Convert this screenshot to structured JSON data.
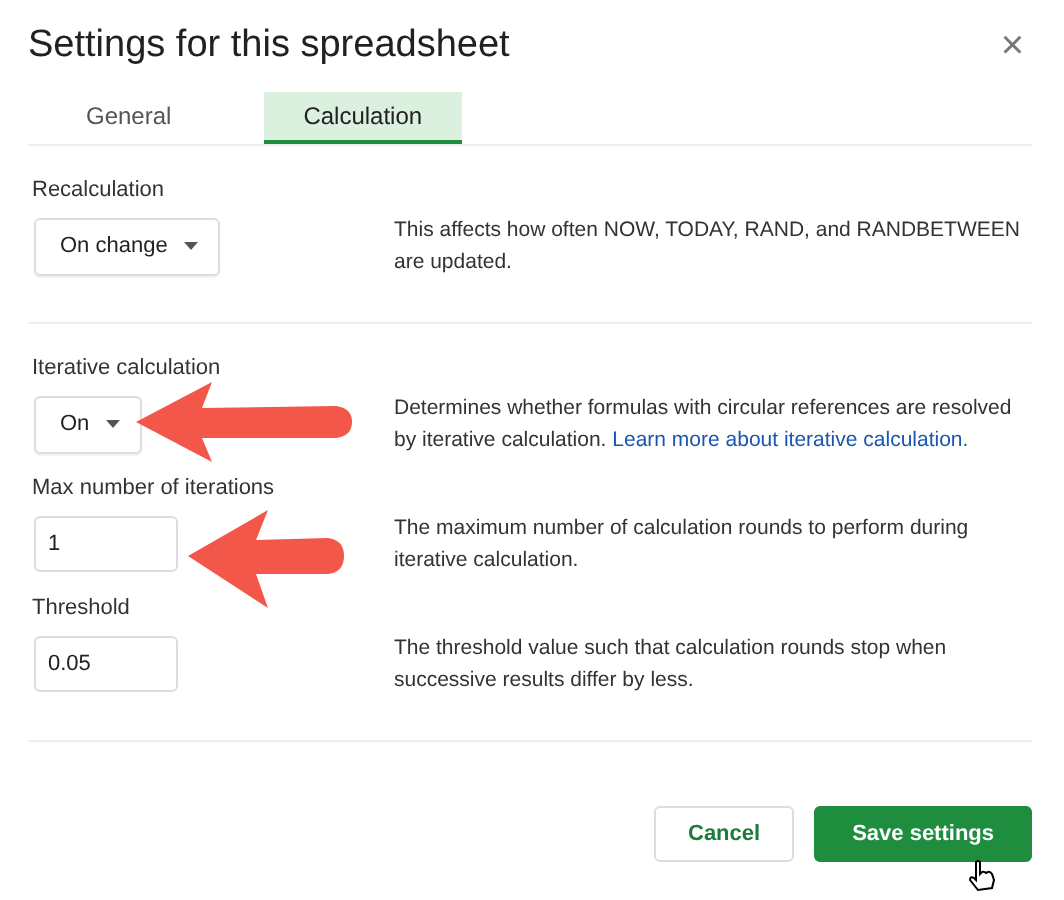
{
  "window": {
    "title": "Settings for this spreadsheet",
    "close": "×"
  },
  "tabs": [
    {
      "label": "General",
      "selected": false
    },
    {
      "label": "Calculation",
      "selected": true
    }
  ],
  "groups": [
    [
      {
        "kind": "dropdown",
        "label": "Recalculation",
        "value": "On change",
        "description": "This affects how often NOW, TODAY, RAND, and RANDBETWEEN are updated."
      }
    ],
    [
      {
        "kind": "dropdown",
        "label": "Iterative calculation",
        "value": "On",
        "description": "Determines whether formulas with circular references are resolved by iterative calculation.",
        "link": "Learn more about iterative calculation."
      },
      {
        "kind": "input",
        "label": "Max number of iterations",
        "value": "1",
        "description": "The maximum number of calculation rounds to perform during iterative calculation."
      },
      {
        "kind": "input",
        "label": "Threshold",
        "value": "0.05",
        "description": "The threshold value such that calculation rounds stop when successive results differ by less."
      }
    ]
  ],
  "buttons": [
    {
      "label": "Cancel",
      "kind": "secondary"
    },
    {
      "label": "Save settings",
      "kind": "primary"
    }
  ]
}
